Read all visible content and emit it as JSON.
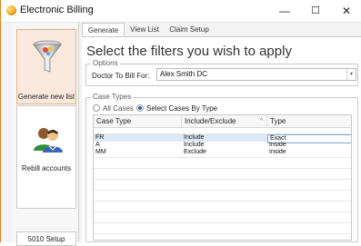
{
  "window": {
    "title": "Electronic Billing",
    "minimize": "—",
    "maximize": "☐",
    "close": "✕"
  },
  "sidebar": {
    "items": [
      {
        "label": "Generate new list"
      },
      {
        "label": "Rebill accounts"
      },
      {
        "label": "5010 Setup"
      }
    ]
  },
  "tabs": [
    {
      "label": "Generate List"
    },
    {
      "label": "View List"
    },
    {
      "label": "Claim Setup"
    }
  ],
  "main": {
    "heading": "Select the filters you wish to apply",
    "options": {
      "legend": "Options",
      "doctor_label": "Doctor To Bill For:",
      "doctor_value": "Alex Smith DC"
    },
    "case_types": {
      "legend": "Case Types",
      "radio_all": "All Cases",
      "radio_select": "Select Cases By Type",
      "columns": [
        "Case Type",
        "Include/Exclude",
        "Type"
      ],
      "sort_indicator": "^",
      "rows": [
        {
          "case_type": "FR",
          "include": "Include",
          "type": "Exact"
        },
        {
          "case_type": "A",
          "include": "Include",
          "type": "Inside"
        },
        {
          "case_type": "MM",
          "include": "Exclude",
          "type": "Inside"
        }
      ]
    }
  },
  "colors": {
    "accent": "#f28f1c",
    "selected_row": "#dbe8f7",
    "active_nav": "#fbe9dd"
  }
}
